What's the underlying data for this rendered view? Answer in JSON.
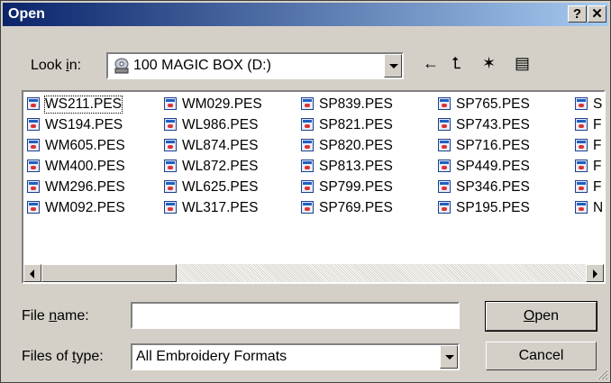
{
  "titlebar": {
    "title": "Open",
    "help_label": "?",
    "close_label": "✕"
  },
  "lookin": {
    "label_pre": "Look ",
    "label_key": "i",
    "label_post": "n:",
    "value": "100 MAGIC BOX (D:)",
    "drive_icon": "disk-drive-icon"
  },
  "toolbar": {
    "back_icon": "←",
    "up_icon": "⮤",
    "newfolder_icon": "✶",
    "views_icon": "▤"
  },
  "files": [
    {
      "col": 0,
      "row": 0,
      "name": "WS211.PES",
      "selected": true
    },
    {
      "col": 0,
      "row": 1,
      "name": "WS194.PES"
    },
    {
      "col": 0,
      "row": 2,
      "name": "WM605.PES"
    },
    {
      "col": 0,
      "row": 3,
      "name": "WM400.PES"
    },
    {
      "col": 0,
      "row": 4,
      "name": "WM296.PES"
    },
    {
      "col": 0,
      "row": 5,
      "name": "WM092.PES"
    },
    {
      "col": 1,
      "row": 0,
      "name": "WM029.PES"
    },
    {
      "col": 1,
      "row": 1,
      "name": "WL986.PES"
    },
    {
      "col": 1,
      "row": 2,
      "name": "WL874.PES"
    },
    {
      "col": 1,
      "row": 3,
      "name": "WL872.PES"
    },
    {
      "col": 1,
      "row": 4,
      "name": "WL625.PES"
    },
    {
      "col": 1,
      "row": 5,
      "name": "WL317.PES"
    },
    {
      "col": 2,
      "row": 0,
      "name": "SP839.PES"
    },
    {
      "col": 2,
      "row": 1,
      "name": "SP821.PES"
    },
    {
      "col": 2,
      "row": 2,
      "name": "SP820.PES"
    },
    {
      "col": 2,
      "row": 3,
      "name": "SP813.PES"
    },
    {
      "col": 2,
      "row": 4,
      "name": "SP799.PES"
    },
    {
      "col": 2,
      "row": 5,
      "name": "SP769.PES"
    },
    {
      "col": 3,
      "row": 0,
      "name": "SP765.PES"
    },
    {
      "col": 3,
      "row": 1,
      "name": "SP743.PES"
    },
    {
      "col": 3,
      "row": 2,
      "name": "SP716.PES"
    },
    {
      "col": 3,
      "row": 3,
      "name": "SP449.PES"
    },
    {
      "col": 3,
      "row": 4,
      "name": "SP346.PES"
    },
    {
      "col": 3,
      "row": 5,
      "name": "SP195.PES"
    },
    {
      "col": 4,
      "row": 0,
      "name": "S"
    },
    {
      "col": 4,
      "row": 1,
      "name": "F"
    },
    {
      "col": 4,
      "row": 2,
      "name": "F"
    },
    {
      "col": 4,
      "row": 3,
      "name": "F"
    },
    {
      "col": 4,
      "row": 4,
      "name": "F"
    },
    {
      "col": 4,
      "row": 5,
      "name": "N"
    }
  ],
  "filename": {
    "label_pre": "File ",
    "label_key": "n",
    "label_post": "ame:",
    "value": ""
  },
  "filetype": {
    "label_pre": "Files of ",
    "label_key": "t",
    "label_post": "ype:",
    "value": "All Embroidery Formats"
  },
  "buttons": {
    "open_key": "O",
    "open_rest": "pen",
    "cancel": "Cancel"
  },
  "colors": {
    "title_start": "#0a246a",
    "title_end": "#a6caf0",
    "face": "#d4d0c8"
  }
}
